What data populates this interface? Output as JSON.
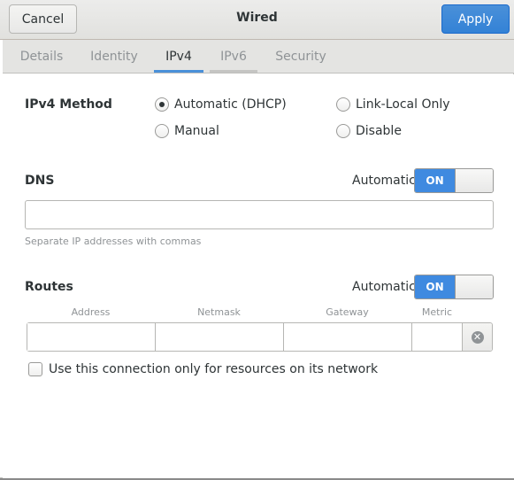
{
  "header": {
    "title": "Wired",
    "cancel_label": "Cancel",
    "apply_label": "Apply"
  },
  "tabs": [
    {
      "label": "Details"
    },
    {
      "label": "Identity"
    },
    {
      "label": "IPv4",
      "active": true
    },
    {
      "label": "IPv6"
    },
    {
      "label": "Security"
    }
  ],
  "ipv4_method": {
    "label": "IPv4 Method",
    "options": [
      {
        "label": "Automatic (DHCP)",
        "checked": true
      },
      {
        "label": "Link-Local Only",
        "checked": false
      },
      {
        "label": "Manual",
        "checked": false
      },
      {
        "label": "Disable",
        "checked": false
      }
    ]
  },
  "dns": {
    "label": "DNS",
    "automatic_label": "Automatic",
    "switch_state": "ON",
    "value": "",
    "hint": "Separate IP addresses with commas"
  },
  "routes": {
    "label": "Routes",
    "automatic_label": "Automatic",
    "switch_state": "ON",
    "columns": [
      "Address",
      "Netmask",
      "Gateway",
      "Metric"
    ],
    "row": {
      "address": "",
      "netmask": "",
      "gateway": "",
      "metric": ""
    }
  },
  "resources_only": {
    "label": "Use this connection only for resources on its network",
    "checked": false
  },
  "colors": {
    "accent": "#4a90d9",
    "switch_on": "#3f8ae0"
  }
}
